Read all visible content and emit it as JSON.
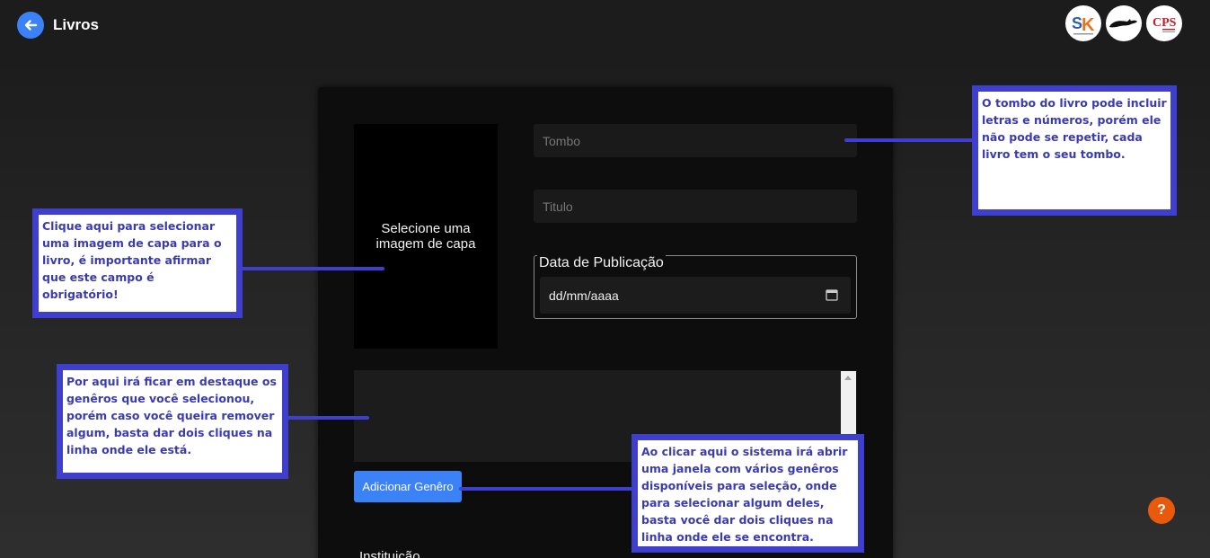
{
  "header": {
    "title": "Livros",
    "back_icon": "arrow-left-icon",
    "logos": [
      "logo-sk",
      "logo-panther",
      "logo-cps"
    ],
    "logo_texts": [
      "SK",
      "CPS"
    ]
  },
  "form": {
    "cover_label": "Selecione uma imagem de capa",
    "tombo_placeholder": "Tombo",
    "titulo_placeholder": "Titulo",
    "date_legend": "Data de Publicação",
    "date_value": "dd/mm/aaaa",
    "add_genre_label": "Adicionar Genêro",
    "institution_label": "Instituição"
  },
  "help": {
    "label": "?"
  },
  "annotations": {
    "tombo": "O tombo do livro pode incluir letras e números, porém ele não pode se repetir, cada livro tem o seu tombo.",
    "cover": "Clique aqui para selecionar uma imagem de capa para o livro, é importante afirmar que este campo é obrigatório!",
    "genres": "Por aqui irá ficar em destaque os genêros que você selecionou, porém caso você queira remover algum, basta dar dois cliques na linha onde ele está.",
    "add_genre": "Ao clicar aqui o sistema irá abrir uma janela com vários genêros disponíveis para seleção, onde para selecionar algum deles, basta você dar dois cliques na linha onde ele se encontra."
  },
  "colors": {
    "accent": "#3b82f6",
    "annotation_border": "#3f3fcf",
    "help": "#e8590c"
  }
}
